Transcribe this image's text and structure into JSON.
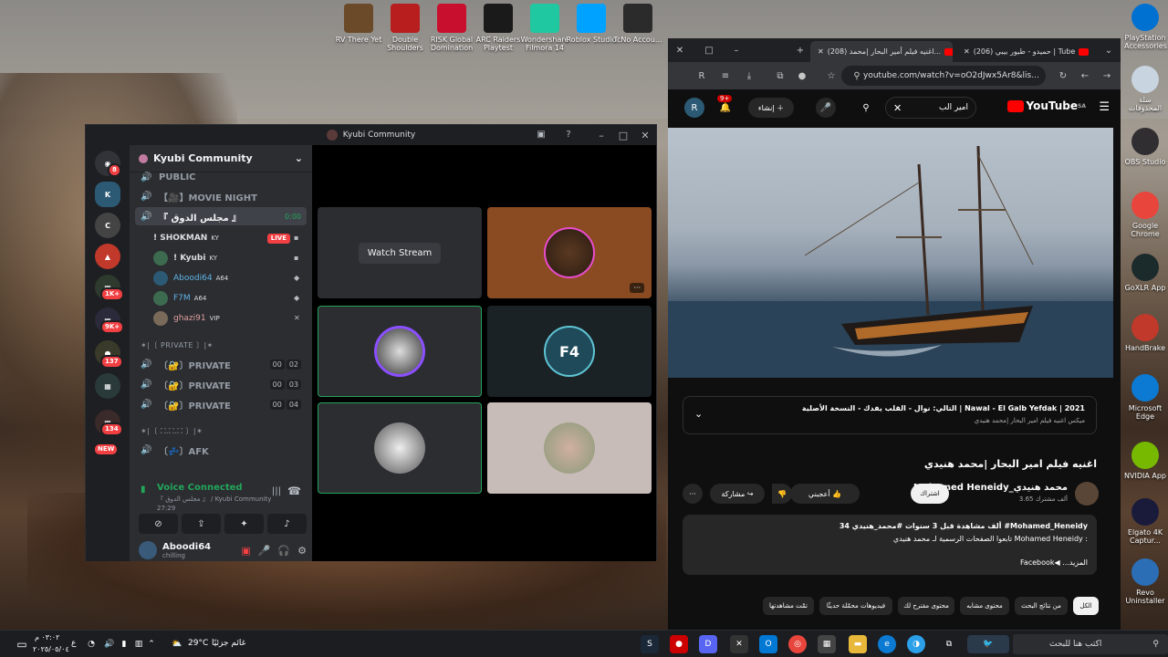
{
  "desktop_icons": [
    {
      "label": "RV There Yet",
      "color": "#6b4a2a"
    },
    {
      "label": "Double Shoulders",
      "color": "#b81e1e"
    },
    {
      "label": "RISK Global Domination",
      "color": "#c8102e"
    },
    {
      "label": "ARC Raiders Playtest",
      "color": "#1a1a1a"
    },
    {
      "label": "Wondershare Filmora 14",
      "color": "#1fc8a0"
    },
    {
      "label": "Roblox Studio",
      "color": "#00a2ff"
    },
    {
      "label": "TcNo Accou...",
      "color": "#2b2b2b"
    }
  ],
  "right_icons": [
    {
      "label": "PlayStation Accessories",
      "color": "#0070d1"
    },
    {
      "label": "سلة المحذوفات",
      "color": "#c8d4e0"
    },
    {
      "label": "OBS Studio",
      "color": "#302e31"
    },
    {
      "label": "Google Chrome",
      "color": "#e8453c"
    },
    {
      "label": "GoXLR App",
      "color": "#1b2a2a"
    },
    {
      "label": "HandBrake",
      "color": "#c0392b"
    },
    {
      "label": "Microsoft Edge",
      "color": "#0c7ad2"
    },
    {
      "label": "NVIDIA App",
      "color": "#76b900"
    },
    {
      "label": "Elgato 4K Captur...",
      "color": "#1a1a3a"
    },
    {
      "label": "Revo Uninstaller",
      "color": "#2c6eb5"
    }
  ],
  "discord": {
    "title": "Kyubi Community",
    "server_name": "Kyubi Community",
    "badges": {
      "top": "8",
      "b1": "1K+",
      "b2": "9K+",
      "b3": "137",
      "b4": "134",
      "new": "NEW"
    },
    "channels": {
      "public": "PUBLIC",
      "movie_night": "【🎥】MOVIE NIGHT",
      "majlis": "『 مجلس الدوق 』",
      "majlis_time": "0:00",
      "private_cat": "✶|〔 PRIVATE 〕|✶",
      "private1": "〔🔐〕PRIVATE",
      "private2": "〔🔐〕PRIVATE",
      "private3": "〔🔐〕PRIVATE",
      "p1_occ": [
        "00",
        "02"
      ],
      "p2_occ": [
        "00",
        "03"
      ],
      "p3_occ": [
        "00",
        "04"
      ],
      "afk_cat": "✶|〔 ⛶.⛶.⛶ 〕|✶",
      "afk": "〔💤〕AFK"
    },
    "voice_users": [
      {
        "name": "! SHOKMAN",
        "tag": "KY",
        "live": "LIVE",
        "color": "#c0392b"
      },
      {
        "name": "! Kyubi",
        "tag": "KY",
        "color": "#3d6b4f"
      },
      {
        "name": "Aboodi64",
        "tag": "A64",
        "color": "#2c5a75"
      },
      {
        "name": "F7M",
        "tag": "A64",
        "color": "#3d6b4f"
      },
      {
        "name": "ghazi91",
        "tag": "VIP",
        "color": "#7a6a5a"
      }
    ],
    "voice": {
      "status": "Voice Connected",
      "channel": "『 مجلس الدوق 』 / Kyubi Community",
      "time": "27:29"
    },
    "user": {
      "name": "Aboodi64",
      "status": "chilling"
    },
    "stage": {
      "watch_stream": "Watch Stream",
      "more": "···"
    }
  },
  "browser": {
    "tabs": [
      "(208) اغنيه فيلم أمير البحار |محمد...",
      "(206) حميدو - طيور بيبي | Tube"
    ],
    "url": "youtube.com/watch?v=oO2dJwx5Ar8&lis...",
    "search_text": "امير الب",
    "create_label": "إنشاء",
    "notif_count": "9+",
    "logo_text": "YouTube",
    "logo_country": "SA",
    "playlist_title": "التالي: نوال - القلب يفدك - النسخة الأصلية | Nawal - El Galb Yefdak | 2021",
    "playlist_sub": "ميكس اغنيه فيلم امير البحار |محمد هنيدي",
    "video_title": "اغنيه فيلم امير البحار |محمد هنيدي",
    "channel_name": "Mohamed Heneidy_محمد هنيدي",
    "channel_subs": "3.65 ألف مشترك",
    "subscribe": "اشتراك",
    "like": "أعجبني",
    "share": "مشاركة",
    "desc_line1": "34 ألف مشاهدة  قبل 3 سنوات  #محمد_هنيدي  #Mohamed_Heneidy",
    "desc_line2": "تابعوا الصفحات الرسمية لـ محمد هنيدي Mohamed Heneidy :",
    "desc_line3": "Facebook◀ ...المزيد",
    "chips": [
      "الكل",
      "من نتائج البحث",
      "محتوى مشابه",
      "محتوى مقترح لك",
      "فيديوهات محمّلة حديثًا",
      "تمّت مشاهدتها"
    ]
  },
  "taskbar": {
    "time": "٠٣:٠٢ م",
    "date": "٢٠٢٥/٠٥/٠٤",
    "lang": "ع",
    "weather": "29°C",
    "weather_text": "غائم جزئيًا",
    "search_placeholder": "اكتب هنا للبحث"
  }
}
